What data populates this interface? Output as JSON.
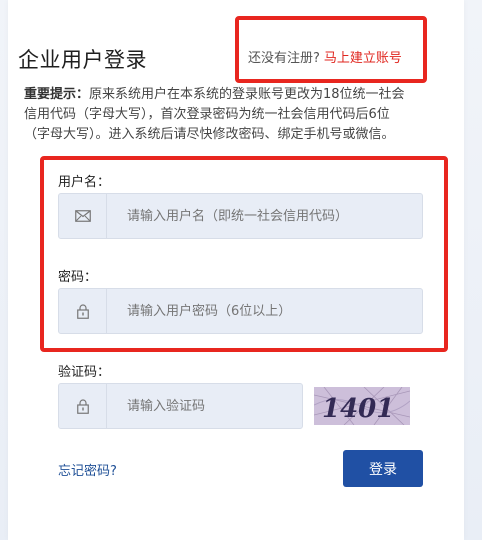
{
  "header": {
    "title": "企业用户登录",
    "register_prompt": "还没有注册?",
    "register_link": "马上建立账号"
  },
  "notice": {
    "label": "重要提示：",
    "line1": "原来系统用户在本系统的登录账号更改为18位统一社会",
    "line2": "信用代码（字母大写），首次登录密码为统一社会信用代码后6位",
    "line3": "（字母大写）。进入系统后请尽快修改密码、绑定手机号或微信。"
  },
  "form": {
    "username_label": "用户名：",
    "username_placeholder": "请输入用户名（即统一社会信用代码）",
    "password_label": "密码：",
    "password_placeholder": "请输入用户密码（6位以上）",
    "captcha_label": "验证码：",
    "captcha_placeholder": "请输入验证码",
    "captcha_image_text": "1401",
    "forgot_link": "忘记密码?",
    "login_button": "登录"
  },
  "colors": {
    "accent": "#2050a4",
    "highlight_border": "#e8261f",
    "link_red": "#e0261f",
    "link_blue": "#1e4f96"
  }
}
